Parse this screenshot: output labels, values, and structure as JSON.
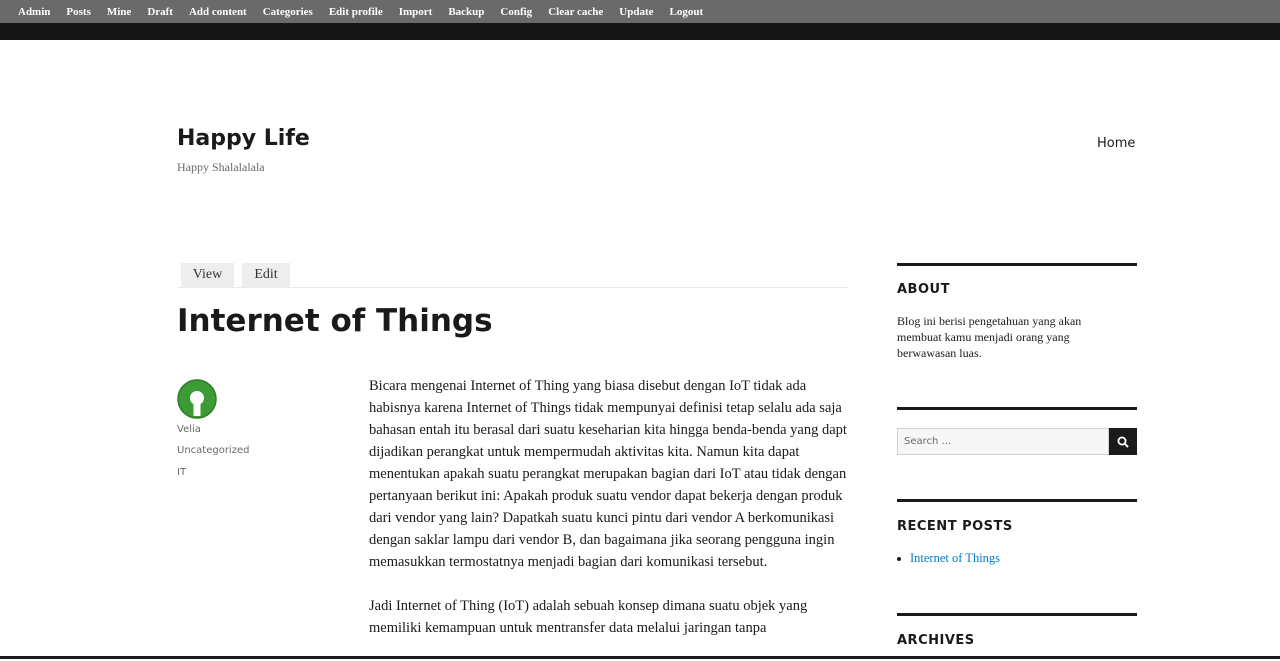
{
  "adminbar": {
    "items": [
      {
        "label": "Admin"
      },
      {
        "label": "Posts"
      },
      {
        "label": "Mine"
      },
      {
        "label": "Draft"
      },
      {
        "label": "Add content"
      },
      {
        "label": "Categories"
      },
      {
        "label": "Edit profile"
      },
      {
        "label": "Import"
      },
      {
        "label": "Backup"
      },
      {
        "label": "Config"
      },
      {
        "label": "Clear cache"
      },
      {
        "label": "Update"
      },
      {
        "label": "Logout"
      }
    ]
  },
  "site": {
    "title": "Happy Life",
    "description": "Happy Shalalalala",
    "nav_home": "Home"
  },
  "tabs": {
    "view": "View",
    "edit": "Edit"
  },
  "post": {
    "title": "Internet of Things",
    "author": "Velia",
    "category": "Uncategorized",
    "tag": "IT",
    "paragraphs": [
      "Bicara mengenai Internet of Thing yang biasa disebut dengan IoT tidak ada habisnya karena Internet of Things tidak mempunyai definisi tetap selalu ada saja bahasan entah itu berasal dari suatu keseharian kita hingga benda-benda yang dapt dijadikan perangkat untuk mempermudah aktivitas kita. Namun kita dapat menentukan apakah suatu perangkat merupakan bagian dari IoT atau tidak dengan pertanyaan berikut ini: Apakah produk suatu vendor dapat bekerja dengan produk dari vendor yang lain? Dapatkah suatu kunci pintu dari vendor A berkomunikasi dengan saklar lampu dari vendor B, dan bagaimana jika seorang pengguna ingin memasukkan termostatnya menjadi bagian dari komunikasi tersebut.",
      "Jadi Internet of Thing (IoT) adalah sebuah konsep dimana suatu objek yang memiliki kemampuan untuk mentransfer data melalui jaringan tanpa"
    ]
  },
  "sidebar": {
    "about_title": "ABOUT",
    "about_text": "Blog ini berisi pengetahuan yang akan membuat kamu menjadi orang yang berwawasan luas.",
    "search_placeholder": "Search ...",
    "recent_title": "RECENT POSTS",
    "recent_items": [
      "Internet of Things"
    ],
    "archives_title": "ARCHIVES"
  },
  "colors": {
    "adminbar_bg": "#6a6a6a",
    "link": "#007acc",
    "avatar_green": "#3d9b35"
  },
  "icons": {
    "avatar": "open-source-keyhole-icon",
    "search": "search-icon"
  }
}
